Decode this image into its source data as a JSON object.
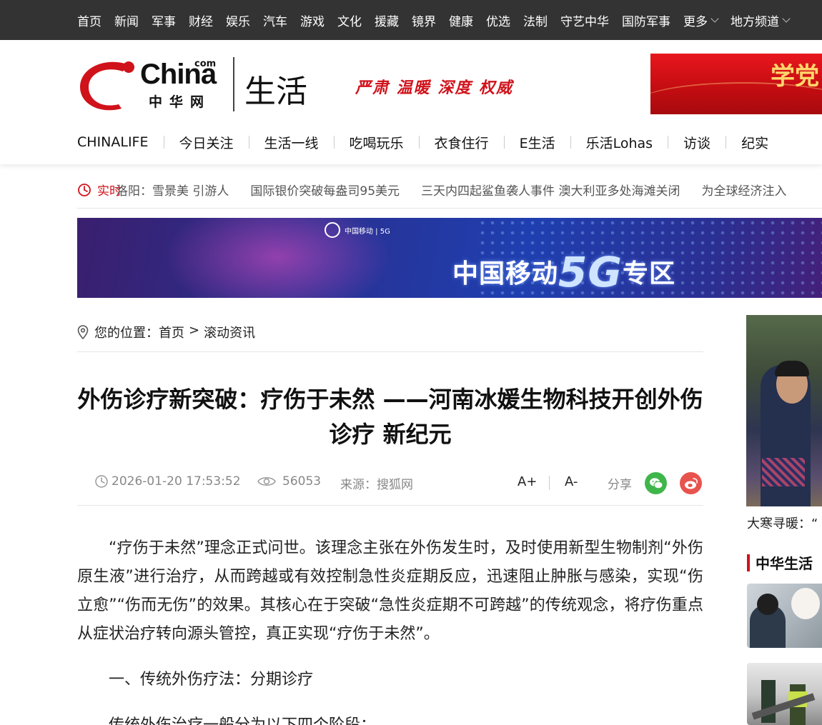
{
  "topnav": [
    "首页",
    "新闻",
    "军事",
    "财经",
    "娱乐",
    "汽车",
    "游戏",
    "文化",
    "援藏",
    "镜界",
    "健康",
    "优选",
    "法制",
    "守艺中华",
    "国防军事",
    "更多",
    "地方频道"
  ],
  "logo": {
    "china": "China",
    "com": "com",
    "cn": "中华网"
  },
  "channel": "生活",
  "slogan": "严肃 温暖 深度 权威",
  "header_banner_text": "学党",
  "mainnav": [
    "CHINALIFE",
    "今日关注",
    "生活一线",
    "吃喝玩乐",
    "衣食住行",
    "E生活",
    "乐活Lohas",
    "访谈",
    "纪实"
  ],
  "ticker": {
    "label": "实时",
    "items": [
      "洛阳：雪景美 引游人",
      "国际银价突破每盎司95美元",
      "三天内四起鲨鱼袭人事件 澳大利亚多处海滩关闭",
      "为全球经济注入"
    ]
  },
  "adbanner": {
    "brand": "中国移动 | 5G",
    "text_pre": "中国移动",
    "text_5g": "5G",
    "text_post": "专区"
  },
  "breadcrumb": {
    "prefix": "您的位置：",
    "home": "首页",
    "gt": ">",
    "current": "滚动资讯"
  },
  "article": {
    "title": "外伤诊疗新突破：疗伤于未然 ——河南冰媛生物科技开创外伤诊疗 新纪元",
    "date": "2026-01-20 17:53:52",
    "views": "56053",
    "source": "来源：搜狐网",
    "font_up": "A+",
    "font_down": "A-",
    "share_label": "分享",
    "paragraphs": [
      "“疗伤于未然”理念正式问世。该理念主张在外伤发生时，及时使用新型生物制剂“外伤原生液”进行治疗，从而跨越或有效控制急性炎症期反应，迅速阻止肿胀与感染，实现“伤立愈”“伤而无伤”的效果。其核心在于突破“急性炎症期不可跨越”的传统观念，将疗伤重点从症状治疗转向源头管控，真正实现“疗伤于未然”。",
      "一、传统外伤疗法：分期诊疗",
      "传统外伤治疗一般分为以下四个阶段："
    ]
  },
  "sidebar": {
    "caption": "大寒寻暖：“",
    "heading": "中华生活"
  },
  "colors": {
    "accent": "#d0121b",
    "topbar": "#333333",
    "wechat": "#3fb64b",
    "weibo": "#e8534e"
  }
}
